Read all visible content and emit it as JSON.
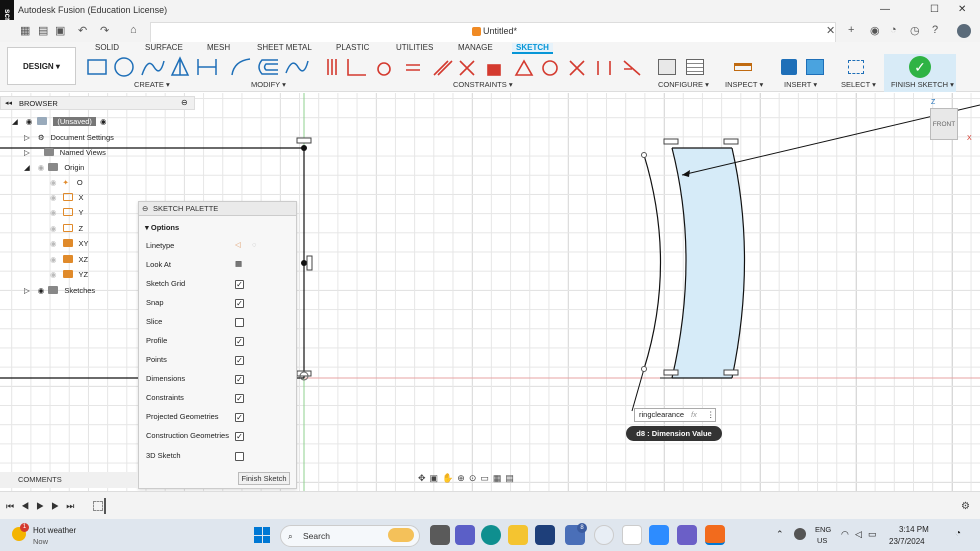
{
  "app": {
    "title": "Autodesk Fusion (Education License)",
    "doc_title": "Untitled*",
    "recorder_label": "screenrec"
  },
  "ribbon": {
    "workspace": "DESIGN",
    "tabs": [
      "SOLID",
      "SURFACE",
      "MESH",
      "SHEET METAL",
      "PLASTIC",
      "UTILITIES",
      "MANAGE",
      "SKETCH"
    ],
    "groups": {
      "create": "CREATE",
      "modify": "MODIFY",
      "constraints": "CONSTRAINTS",
      "configure": "CONFIGURE",
      "inspect": "INSPECT",
      "insert": "INSERT",
      "select": "SELECT",
      "finish": "FINISH SKETCH"
    }
  },
  "browser": {
    "title": "BROWSER",
    "root": "(Unsaved)",
    "items": [
      "Document Settings",
      "Named Views",
      "Origin",
      "O",
      "X",
      "Y",
      "Z",
      "XY",
      "XZ",
      "YZ",
      "Sketches"
    ]
  },
  "palette": {
    "title": "SKETCH PALETTE",
    "section": "Options",
    "rows": [
      {
        "label": "Linetype",
        "type": "icons"
      },
      {
        "label": "Look At",
        "type": "icon"
      },
      {
        "label": "Sketch Grid",
        "checked": true
      },
      {
        "label": "Snap",
        "checked": true
      },
      {
        "label": "Slice",
        "checked": false
      },
      {
        "label": "Profile",
        "checked": true
      },
      {
        "label": "Points",
        "checked": true
      },
      {
        "label": "Dimensions",
        "checked": true
      },
      {
        "label": "Constraints",
        "checked": true
      },
      {
        "label": "Projected Geometries",
        "checked": true
      },
      {
        "label": "Construction Geometries",
        "checked": true
      },
      {
        "label": "3D Sketch",
        "checked": false
      }
    ],
    "finish_button": "Finish Sketch"
  },
  "dimension": {
    "value": "ringclearance",
    "fx": "fx",
    "tooltip": "d8 : Dimension Value"
  },
  "viewcube": {
    "label": "FRONT",
    "z": "Z",
    "x": "X"
  },
  "comments": {
    "label": "COMMENTS"
  },
  "taskbar": {
    "weather_title": "Hot weather",
    "weather_sub": "Now",
    "weather_badge": "1",
    "search": "Search",
    "teams_badge": "8",
    "lang": "ENG",
    "region": "US",
    "time": "3:14 PM",
    "date": "23/7/2024"
  },
  "colors": {
    "accent": "#0696d7",
    "finish_green": "#2fb344",
    "profile_fill": "#d6ebf8"
  }
}
